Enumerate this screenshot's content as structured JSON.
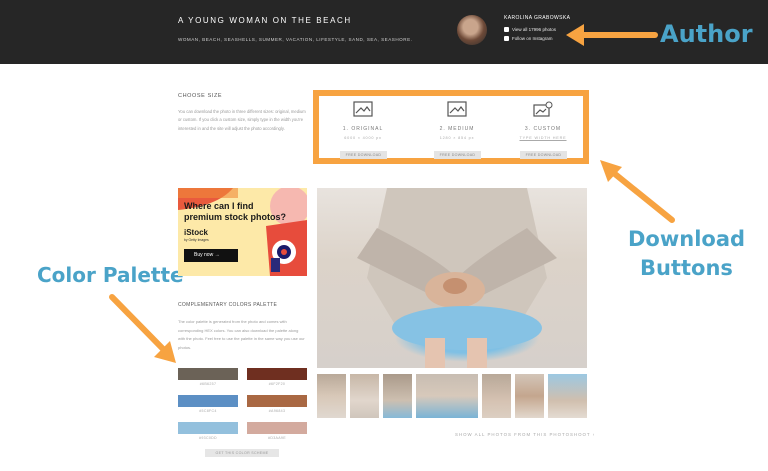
{
  "header": {
    "title": "A YOUNG WOMAN ON THE BEACH",
    "tags": "WOMAN, BEACH, SEASHELLS, SUMMER, VACATION, LIFESTYLE, SAND, SEA, SEASHORE.",
    "author": {
      "name": "KAROLINA GRABOWSKA",
      "view_all": "View all 17996 photos",
      "instagram": "Follow on Instagram"
    }
  },
  "annotations": {
    "author": "Author",
    "download_line1": "Download",
    "download_line2": "Buttons",
    "palette": "Color Palette"
  },
  "choose_size": {
    "heading": "CHOOSE SIZE",
    "description": "You can download the photo in three different sizes: original, medium or custom. If you click a custom size, simply type in the width you're interested in and the site will adjust the photo accordingly.",
    "options": [
      {
        "label": "1. ORIGINAL",
        "dims": "6000 × 4000 px",
        "button": "FREE DOWNLOAD"
      },
      {
        "label": "2. MEDIUM",
        "dims": "1280 × 854 px",
        "button": "FREE DOWNLOAD"
      },
      {
        "label": "3. CUSTOM",
        "dims": "TYPE WIDTH HERE",
        "button": "FREE DOWNLOAD"
      }
    ]
  },
  "ad": {
    "headline_1": "Where can I find",
    "headline_2": "premium stock photos?",
    "brand": "iStock",
    "brand_sub": "by Getty Images",
    "button": "Buy now →"
  },
  "palette": {
    "heading": "COMPLEMENTARY COLORS PALETTE",
    "description": "The color palette is generated from the photo and comes with corresponding HEX colors. You can also download the palette along with the photo. Feel free to use the palette in the same way you use our photos.",
    "swatches": [
      {
        "color": "#6b6257",
        "hex": "#6B6257"
      },
      {
        "color": "#6f2f20",
        "hex": "#6F2F20"
      },
      {
        "color": "#5c8fc4",
        "hex": "#5C8FC4"
      },
      {
        "color": "#a96843",
        "hex": "#A96843"
      },
      {
        "color": "#93c0dd",
        "hex": "#93C0DD"
      },
      {
        "color": "#d3aa9e",
        "hex": "#D3AA9E"
      }
    ],
    "button": "GET THIS COLOR SCHEME"
  },
  "gallery": {
    "show_all": "SHOW ALL PHOTOS FROM THIS PHOTOSHOOT ›"
  },
  "colors": {
    "annotation_orange": "#f7a341",
    "annotation_blue": "#4aa3c8",
    "header_bg": "#262626"
  }
}
